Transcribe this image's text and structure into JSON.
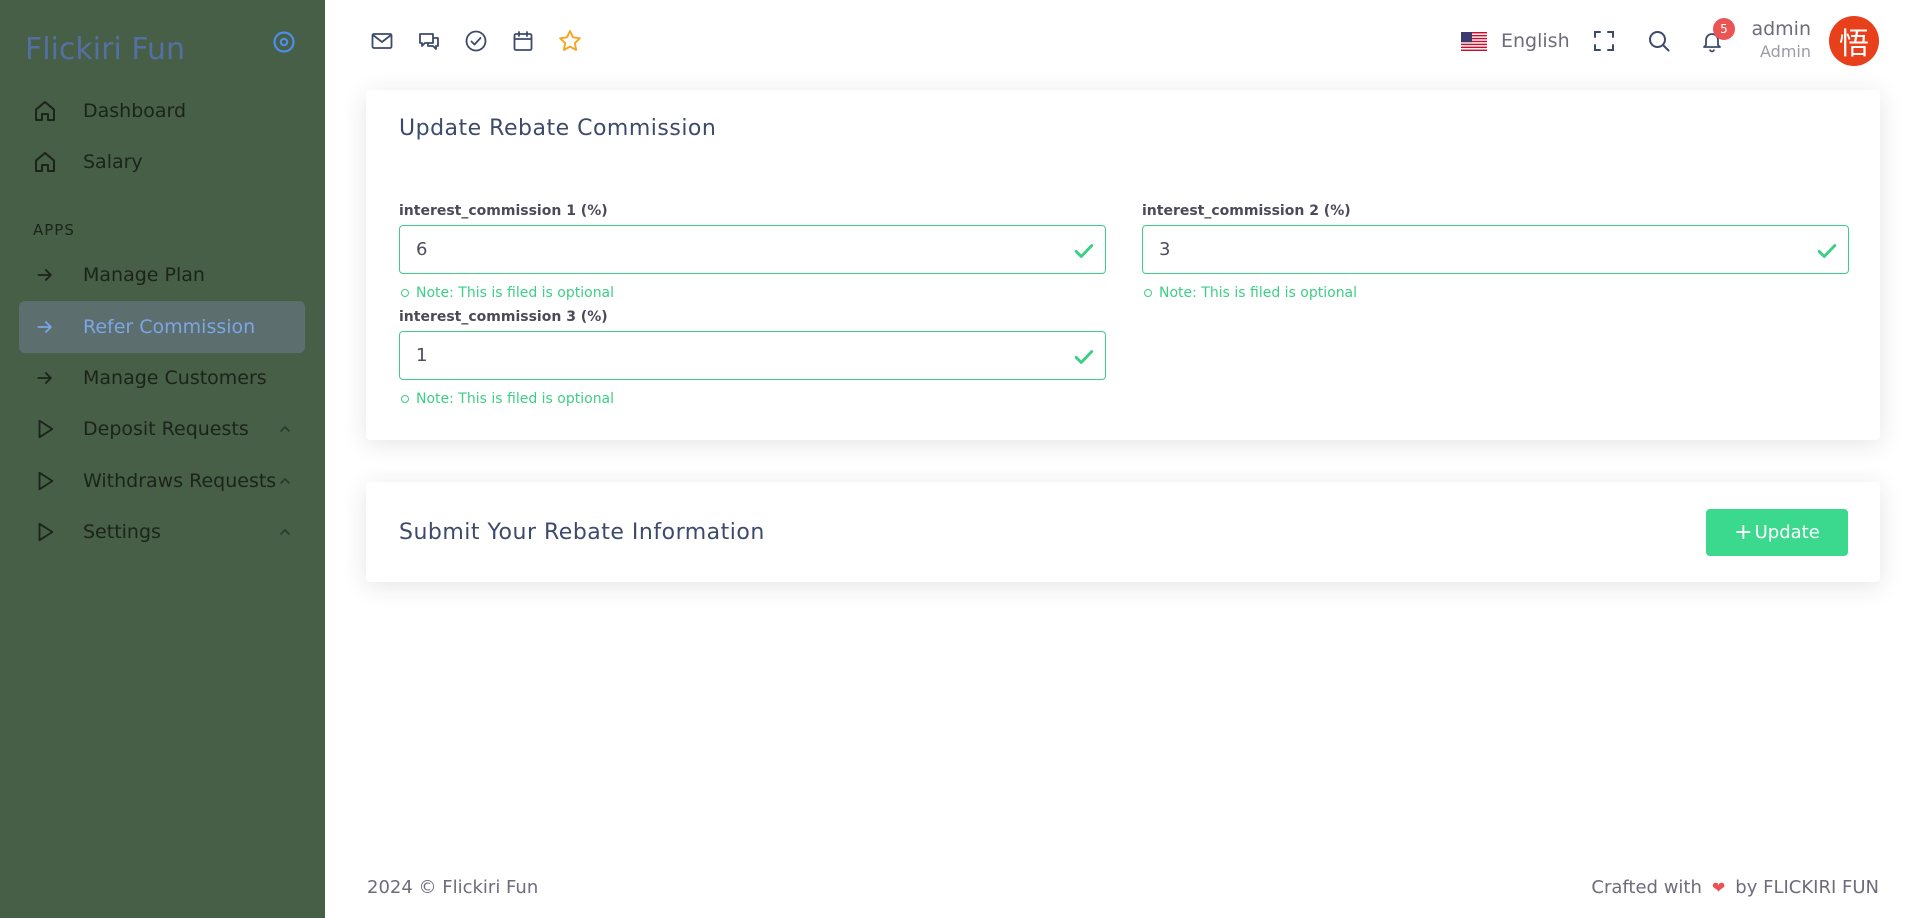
{
  "brand": {
    "name": "Flickiri Fun"
  },
  "sidebar": {
    "items": [
      {
        "label": "Dashboard",
        "icon": "home-icon"
      },
      {
        "label": "Salary",
        "icon": "home-icon"
      }
    ],
    "section_header": "APPS",
    "apps": [
      {
        "label": "Manage Plan",
        "icon": "arrow-right-icon"
      },
      {
        "label": "Refer Commission",
        "icon": "arrow-right-icon",
        "active": true
      },
      {
        "label": "Manage Customers",
        "icon": "arrow-right-icon"
      },
      {
        "label": "Deposit Requests",
        "icon": "play-icon",
        "expandable": true
      },
      {
        "label": "Withdraws Requests",
        "icon": "play-icon",
        "expandable": true
      },
      {
        "label": "Settings",
        "icon": "play-icon",
        "expandable": true
      }
    ]
  },
  "topbar": {
    "shortcut_icons": [
      "mail-icon",
      "chat-icon",
      "check-circle-icon",
      "calendar-icon",
      "star-icon"
    ],
    "language": "English",
    "notification_count": "5",
    "user_name": "admin",
    "user_role": "Admin",
    "avatar_char": "悟"
  },
  "form": {
    "title": "Update Rebate Commission",
    "fields": [
      {
        "label": "interest_commission 1 (%)",
        "value": "6",
        "note": "Note: This is filed is optional"
      },
      {
        "label": "interest_commission 2 (%)",
        "value": "3",
        "note": "Note: This is filed is optional"
      },
      {
        "label": "interest_commission 3 (%)",
        "value": "1",
        "note": "Note: This is filed is optional"
      }
    ]
  },
  "submit": {
    "title": "Submit Your Rebate Information",
    "button_label": "Update"
  },
  "footer": {
    "left": "2024 © Flickiri Fun",
    "right_prefix": "Crafted with",
    "right_suffix": "by FLICKIRI FUN"
  },
  "colors": {
    "sidebar_bg": "#475e47",
    "accent_green": "#3ad98e",
    "active_blue": "#7ba5e6",
    "badge_red": "#ea5455",
    "star_orange": "#f5a623"
  }
}
